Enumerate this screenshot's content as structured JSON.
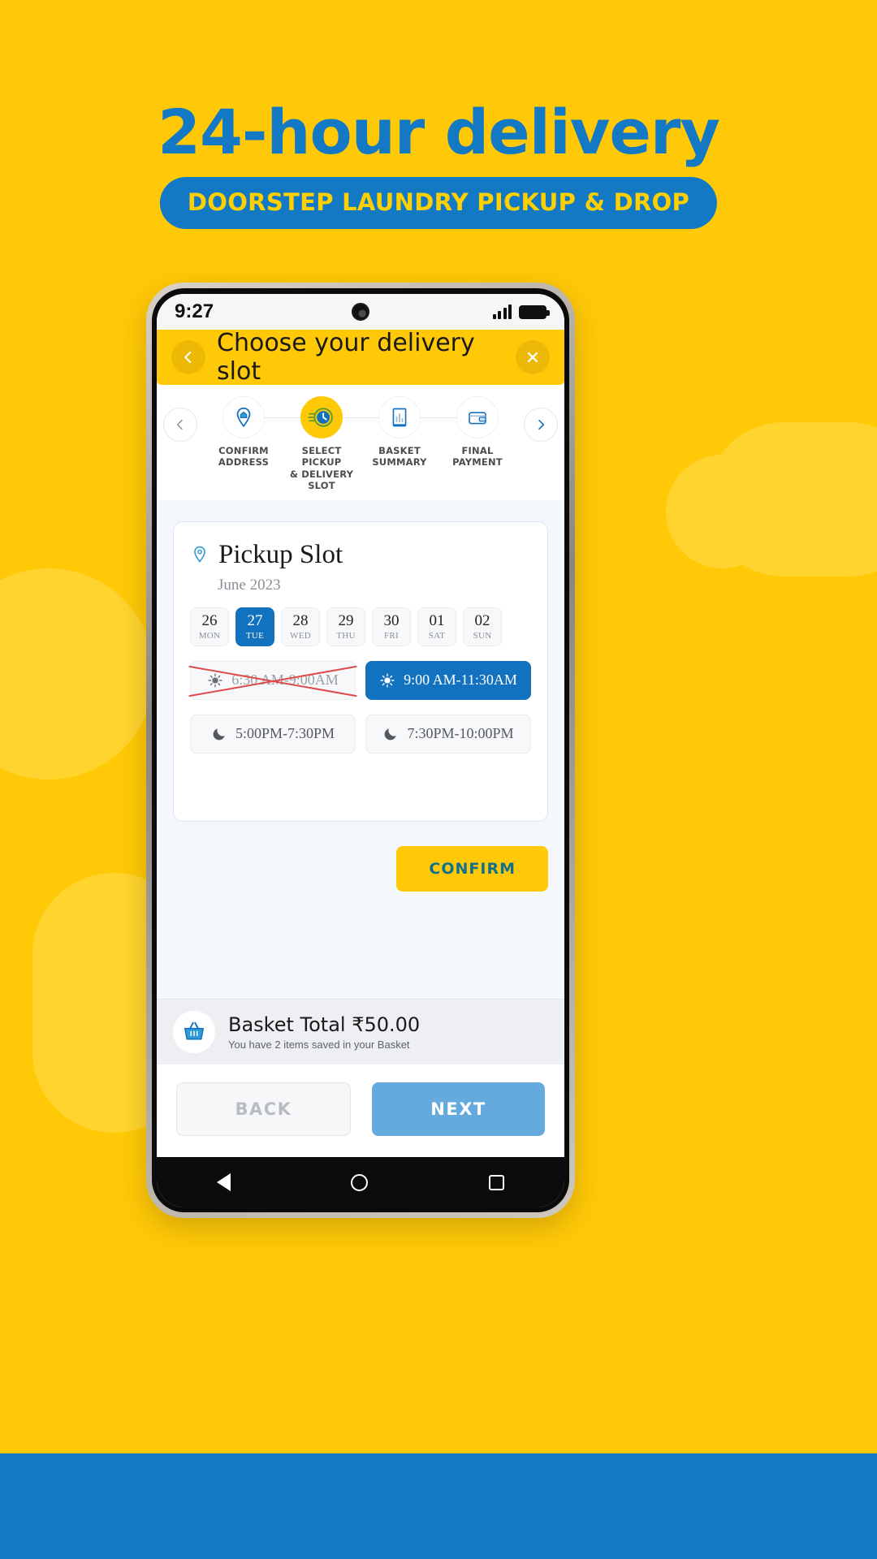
{
  "promo": {
    "headline": "24-hour delivery",
    "banner": "DOORSTEP LAUNDRY PICKUP & DROP",
    "colors": {
      "background": "#FFC907",
      "accent": "#1479C4",
      "band": "#1479C4"
    }
  },
  "phone": {
    "status": {
      "time": "9:27",
      "signal_icon": "cellular-signal-icon",
      "battery_icon": "battery-full-icon",
      "camera_icon": "front-camera-icon"
    },
    "appbar": {
      "back_icon": "chevron-left-icon",
      "title": "Choose your delivery slot",
      "close_icon": "close-icon"
    },
    "stepper": {
      "prev_icon": "chevron-left-icon",
      "next_icon": "chevron-right-icon",
      "steps": [
        {
          "icon": "location-pin-home-icon",
          "line1": "CONFIRM",
          "line2": "ADDRESS",
          "active": false
        },
        {
          "icon": "speed-clock-icon",
          "line1": "SELECT PICKUP",
          "line2": "& DELIVERY SLOT",
          "active": true
        },
        {
          "icon": "receipt-icon",
          "line1": "BASKET",
          "line2": "SUMMARY",
          "active": false
        },
        {
          "icon": "wallet-icon",
          "line1": "FINAL",
          "line2": "PAYMENT",
          "active": false
        }
      ]
    },
    "pickup_card": {
      "pin_icon": "location-pin-icon",
      "title": "Pickup Slot",
      "month": "June 2023",
      "dates": [
        {
          "num": "26",
          "day": "MON",
          "selected": false
        },
        {
          "num": "27",
          "day": "TUE",
          "selected": true
        },
        {
          "num": "28",
          "day": "WED",
          "selected": false
        },
        {
          "num": "29",
          "day": "THU",
          "selected": false
        },
        {
          "num": "30",
          "day": "FRI",
          "selected": false
        },
        {
          "num": "01",
          "day": "SAT",
          "selected": false
        },
        {
          "num": "02",
          "day": "SUN",
          "selected": false
        }
      ],
      "slots": [
        {
          "label": "6:30 AM-9:00AM",
          "icon": "sun-icon",
          "state": "disabled"
        },
        {
          "label": "9:00 AM-11:30AM",
          "icon": "sun-icon",
          "state": "selected"
        },
        {
          "label": "5:00PM-7:30PM",
          "icon": "moon-icon",
          "state": "default"
        },
        {
          "label": "7:30PM-10:00PM",
          "icon": "moon-icon",
          "state": "default"
        }
      ],
      "confirm_label": "CONFIRM"
    },
    "basket": {
      "icon": "shopping-basket-icon",
      "total": "Basket Total ₹50.00",
      "note": "You have 2 items saved in your Basket"
    },
    "footer": {
      "back_label": "BACK",
      "next_label": "NEXT"
    },
    "navbar": {
      "back_icon": "android-back-icon",
      "home_icon": "android-home-icon",
      "recents_icon": "android-recents-icon"
    }
  }
}
